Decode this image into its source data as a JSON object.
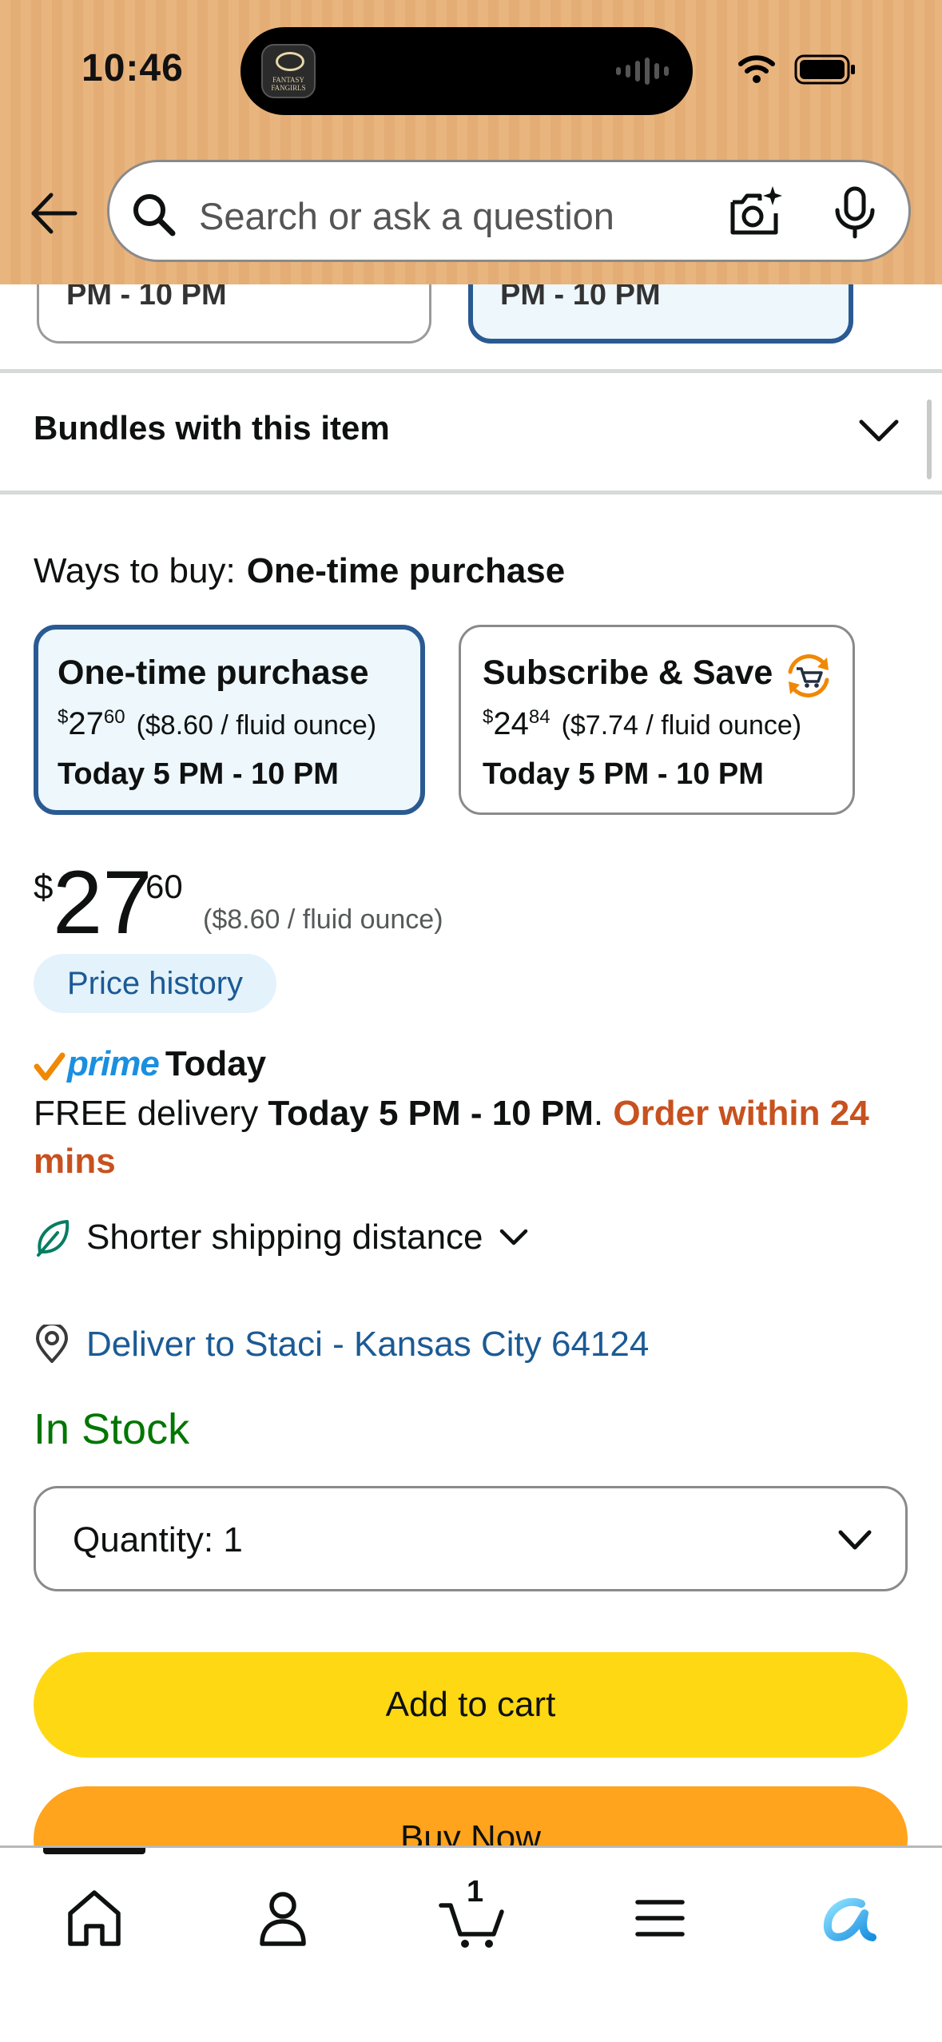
{
  "status_bar": {
    "time": "10:46",
    "live_activity_app": "FANTASY FANGIRLS"
  },
  "search": {
    "placeholder": "Search or ask a question"
  },
  "partial_cards": {
    "left_text": "PM - 10 PM",
    "right_text": "PM - 10 PM"
  },
  "bundles": {
    "title": "Bundles with this item"
  },
  "ways_to_buy": {
    "label": "Ways to buy:",
    "selected": "One-time purchase"
  },
  "options": [
    {
      "title": "One-time purchase",
      "currency": "$",
      "price_whole": "27",
      "price_fraction": "60",
      "unit_price": "($8.60 / fluid ounce)",
      "delivery": "Today 5 PM - 10 PM"
    },
    {
      "title": "Subscribe & Save",
      "currency": "$",
      "price_whole": "24",
      "price_fraction": "84",
      "unit_price": "($7.74 / fluid ounce)",
      "delivery": "Today 5 PM - 10 PM"
    }
  ],
  "price": {
    "currency": "$",
    "whole": "27",
    "fraction": "60",
    "unit_price": "($8.60 / fluid ounce)",
    "history_label": "Price history"
  },
  "prime": {
    "word": "prime",
    "today": "Today"
  },
  "delivery": {
    "prefix": "FREE delivery ",
    "window": "Today 5 PM - 10 PM",
    "period": ". ",
    "countdown": "Order within 24 mins"
  },
  "shipping": {
    "label": "Shorter shipping distance"
  },
  "deliver_to": {
    "label": "Deliver to Staci - Kansas City 64124"
  },
  "stock": {
    "status": "In Stock"
  },
  "quantity": {
    "label": "Quantity:",
    "value": "1"
  },
  "buttons": {
    "add_to_cart": "Add to cart",
    "buy_now": "Buy Now"
  },
  "bottom_nav": {
    "cart_count": "1"
  },
  "colors": {
    "header_bg": "#e9b57f",
    "selected_border": "#2a5a92",
    "selected_bg": "#edf7fc",
    "link": "#1b5a95",
    "in_stock": "#007600",
    "countdown": "#c7511f",
    "add_to_cart": "#ffd814",
    "buy_now": "#ffa41c",
    "prime_blue": "#1a8fe0"
  }
}
